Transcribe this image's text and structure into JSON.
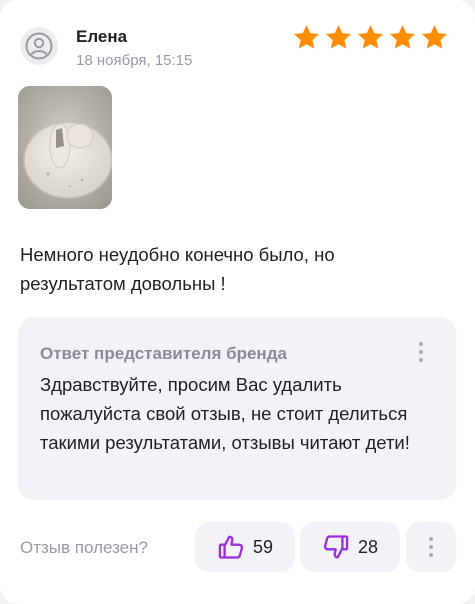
{
  "review": {
    "author": "Елена",
    "date": "18 ноября, 15:15",
    "rating": 5,
    "rating_max": 5,
    "star_color": "#ff8c00",
    "avatar_icon": "user-icon",
    "text": "Немного неудобно конечно было, но результатом довольны !"
  },
  "brand_reply": {
    "title": "Ответ представителя бренда",
    "text": "Здравствуйте, просим Вас удалить пожалуйста свой отзыв, не стоит делиться такими результатами, отзывы читают дети!",
    "menu_icon": "more-vertical-icon"
  },
  "footer": {
    "helpful_label": "Отзыв полезен?",
    "likes": "59",
    "dislikes": "28",
    "accent_color": "#9b2fe0",
    "like_icon": "thumbs-up-icon",
    "dislike_icon": "thumbs-down-icon",
    "more_icon": "more-vertical-icon"
  }
}
